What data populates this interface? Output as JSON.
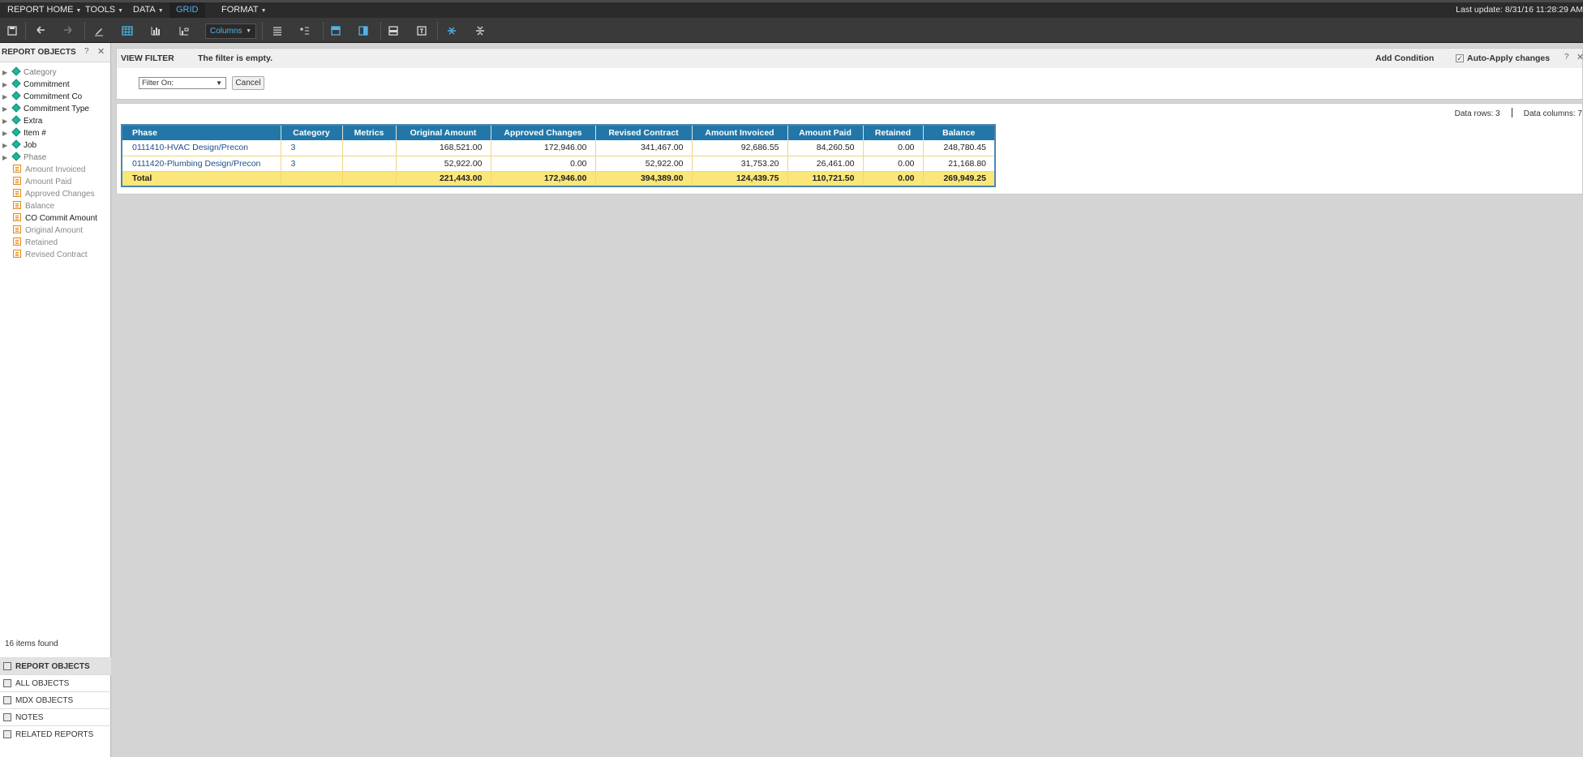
{
  "menu": {
    "items": [
      {
        "label": "REPORT HOME",
        "caret": true
      },
      {
        "label": "TOOLS",
        "caret": true
      },
      {
        "label": "DATA",
        "caret": true
      },
      {
        "label": "GRID",
        "caret": false
      },
      {
        "label": "FORMAT",
        "caret": true
      }
    ],
    "active": "GRID",
    "last_update": "Last update: 8/31/16 11:28:29 AM"
  },
  "toolbar": {
    "columns_select": "Columns",
    "icons": [
      "save-icon",
      "undo-icon",
      "redo-icon",
      "edit-icon",
      "grid-view-icon",
      "bar-chart-icon",
      "grid-graph-icon",
      "rows-icon",
      "add-row-icon",
      "banding-icon",
      "column-banding-icon",
      "subtotals-icon",
      "totals-icon",
      "expand-icon",
      "collapse-icon"
    ],
    "accent": "#4fb3ec"
  },
  "left_panel": {
    "title": "REPORT OBJECTS",
    "help": "?",
    "close": "✕",
    "attributes": [
      {
        "label": "Category",
        "dim": true
      },
      {
        "label": "Commitment",
        "dim": false
      },
      {
        "label": "Commitment Co",
        "dim": false
      },
      {
        "label": "Commitment Type",
        "dim": false
      },
      {
        "label": "Extra",
        "dim": false
      },
      {
        "label": "Item #",
        "dim": false
      },
      {
        "label": "Job",
        "dim": false
      },
      {
        "label": "Phase",
        "dim": true
      }
    ],
    "metrics": [
      {
        "label": "Amount Invoiced",
        "dark": false
      },
      {
        "label": "Amount Paid",
        "dark": false
      },
      {
        "label": "Approved Changes",
        "dark": false
      },
      {
        "label": "Balance",
        "dark": false
      },
      {
        "label": "CO Commit Amount",
        "dark": true
      },
      {
        "label": "Original Amount",
        "dark": false
      },
      {
        "label": "Retained",
        "dark": false
      },
      {
        "label": "Revised Contract",
        "dark": false
      }
    ],
    "items_found": "16 items found",
    "sections": [
      {
        "label": "REPORT OBJECTS",
        "active": true
      },
      {
        "label": "ALL OBJECTS",
        "active": false
      },
      {
        "label": "MDX OBJECTS",
        "active": false
      },
      {
        "label": "NOTES",
        "active": false
      },
      {
        "label": "RELATED REPORTS",
        "active": false
      }
    ]
  },
  "view_filter": {
    "title": "VIEW FILTER",
    "status": "The filter is empty.",
    "add_condition": "Add Condition",
    "auto_apply": "Auto-Apply changes",
    "auto_apply_checked": true,
    "help": "?",
    "close": "✕",
    "select_value": "Filter On:",
    "cancel": "Cancel"
  },
  "grid": {
    "data_rows": "Data rows: 3",
    "data_columns": "Data columns: 7",
    "headers": [
      "Phase",
      "Category",
      "Metrics",
      "Original Amount",
      "Approved Changes",
      "Revised Contract",
      "Amount Invoiced",
      "Amount Paid",
      "Retained",
      "Balance"
    ],
    "rows": [
      [
        "0111410-HVAC Design/Precon",
        "3",
        "",
        "168,521.00",
        "172,946.00",
        "341,467.00",
        "92,686.55",
        "84,260.50",
        "0.00",
        "248,780.45"
      ],
      [
        "0111420-Plumbing Design/Precon",
        "3",
        "",
        "52,922.00",
        "0.00",
        "52,922.00",
        "31,753.20",
        "26,461.00",
        "0.00",
        "21,168.80"
      ]
    ],
    "total": [
      "Total",
      "",
      "",
      "221,443.00",
      "172,946.00",
      "394,389.00",
      "124,439.75",
      "110,721.50",
      "0.00",
      "269,949.25"
    ],
    "header_color": "#2277a8",
    "total_color": "#fbe67a"
  }
}
